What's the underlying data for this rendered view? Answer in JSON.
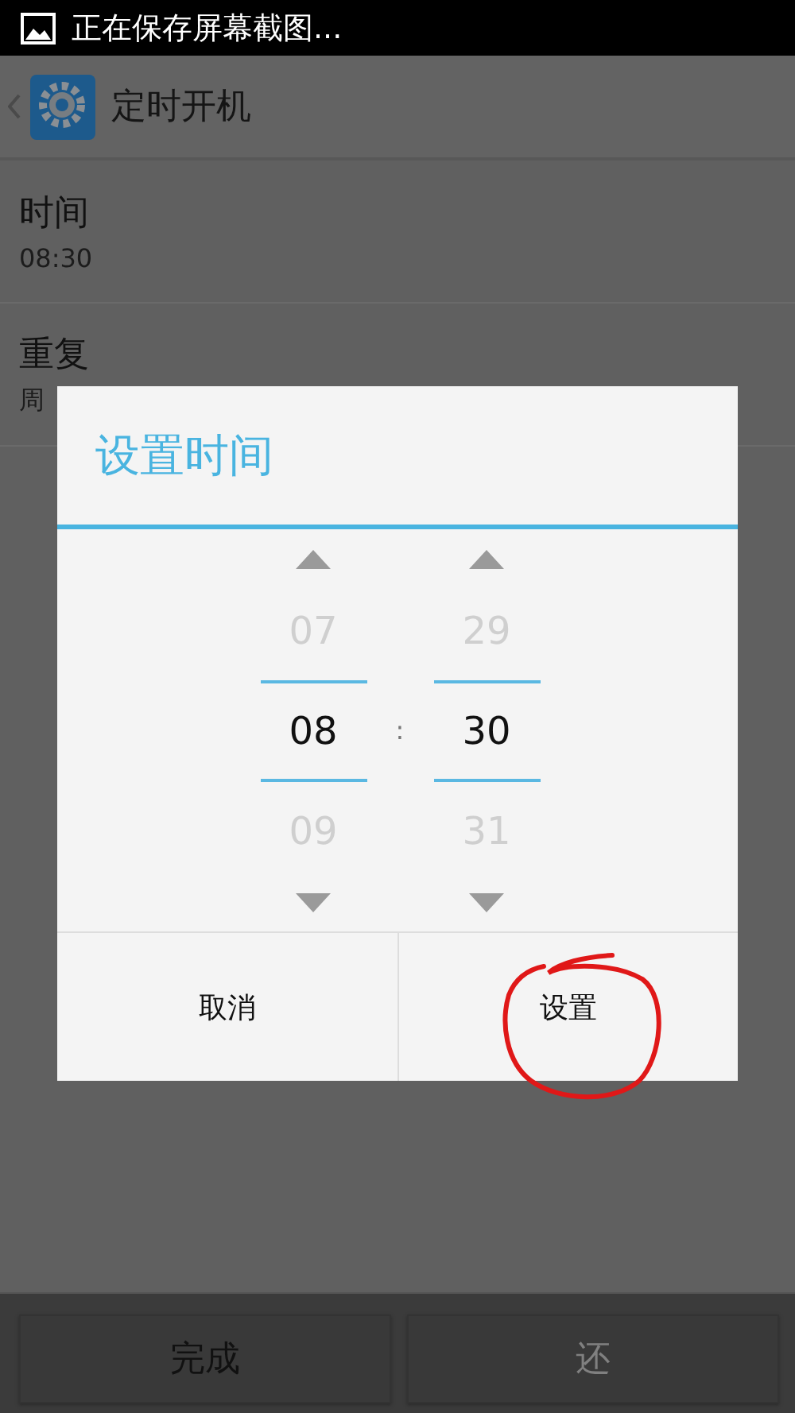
{
  "status_bar": {
    "notification": "正在保存屏幕截图..."
  },
  "action_bar": {
    "title": "定时开机"
  },
  "settings": [
    {
      "label": "时间",
      "value": "08:30"
    },
    {
      "label": "重复",
      "value": "周"
    }
  ],
  "dialog": {
    "title": "设置时间",
    "separator": ":",
    "pickers": [
      {
        "previous": "07",
        "current": "08",
        "next": "09"
      },
      {
        "previous": "29",
        "current": "30",
        "next": "31"
      }
    ],
    "buttons": [
      {
        "label": "取消",
        "circled": false
      },
      {
        "label": "设置",
        "circled": true
      }
    ]
  },
  "bottom_bar": [
    {
      "label": "完成",
      "disabled": false
    },
    {
      "label": "还",
      "disabled": true
    }
  ]
}
